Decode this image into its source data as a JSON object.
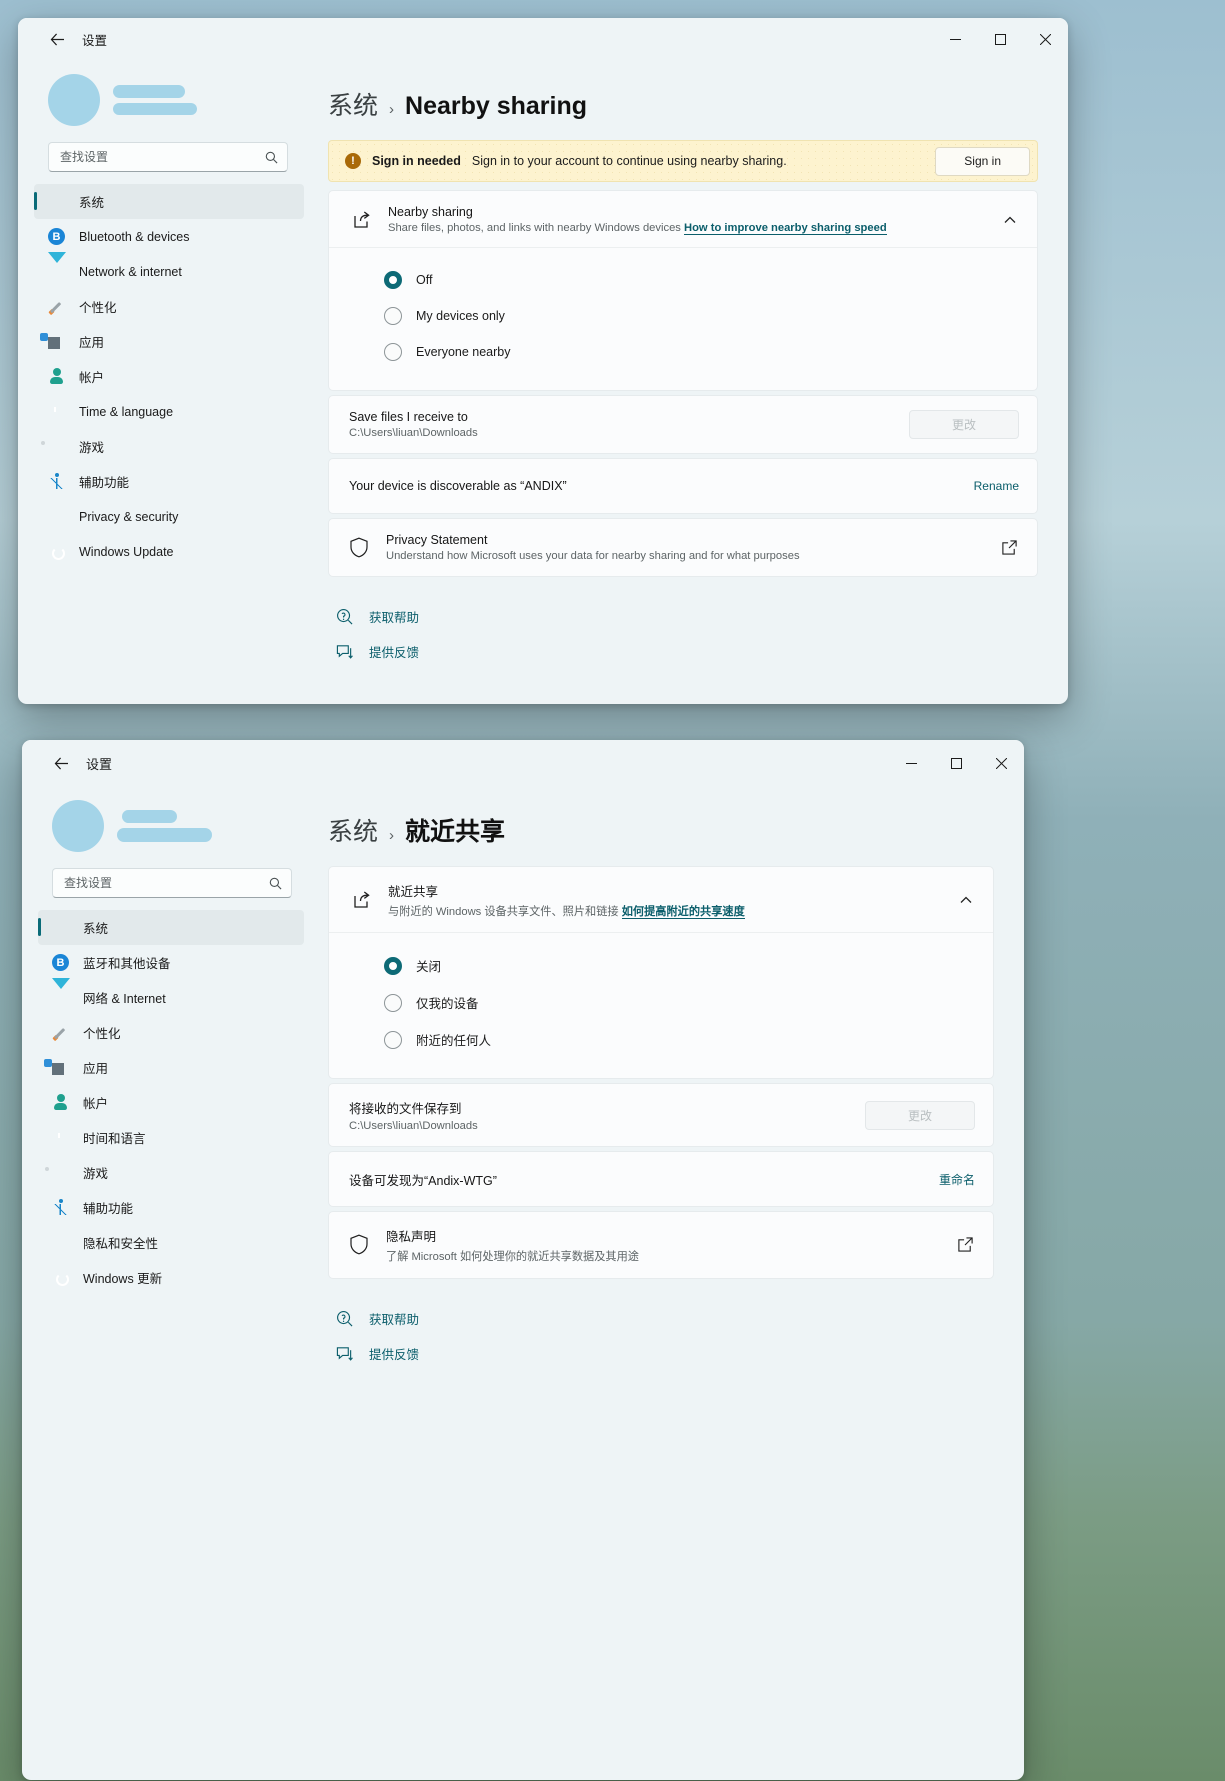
{
  "wallpaper": {
    "accent": "#9fc0cf"
  },
  "window_en": {
    "titlebar": {
      "title": "设置",
      "back_icon": "back-arrow-icon",
      "minimize": "minimize-icon",
      "maximize": "maximize-icon",
      "close": "close-icon"
    },
    "sidebar": {
      "search": {
        "placeholder": "查找设置",
        "value": "",
        "icon": "search-icon"
      },
      "items": [
        {
          "label": "系统",
          "icon": "system-icon",
          "active": true
        },
        {
          "label": "Bluetooth & devices",
          "icon": "bluetooth-icon",
          "active": false
        },
        {
          "label": "Network & internet",
          "icon": "network-icon",
          "active": false
        },
        {
          "label": "个性化",
          "icon": "personalization-icon",
          "active": false
        },
        {
          "label": "应用",
          "icon": "apps-icon",
          "active": false
        },
        {
          "label": "帐户",
          "icon": "accounts-icon",
          "active": false
        },
        {
          "label": "Time & language",
          "icon": "time-icon",
          "active": false
        },
        {
          "label": "游戏",
          "icon": "gaming-icon",
          "active": false
        },
        {
          "label": "辅助功能",
          "icon": "accessibility-icon",
          "active": false
        },
        {
          "label": "Privacy & security",
          "icon": "privacy-icon",
          "active": false
        },
        {
          "label": "Windows Update",
          "icon": "update-icon",
          "active": false
        }
      ]
    },
    "breadcrumb": {
      "root": "系统",
      "separator": "›",
      "current": "Nearby sharing"
    },
    "banner": {
      "icon": "alert-icon",
      "strong": "Sign in needed",
      "message": "Sign in to your account to continue using nearby sharing.",
      "button": "Sign in"
    },
    "feature_card": {
      "icon": "share-icon",
      "title": "Nearby sharing",
      "subtitle": "Share files, photos, and links with nearby Windows devices",
      "link": "How to improve nearby sharing speed",
      "chevron": "chevron-up-icon"
    },
    "options": [
      {
        "label": "Off",
        "selected": true
      },
      {
        "label": "My devices only",
        "selected": false
      },
      {
        "label": "Everyone nearby",
        "selected": false
      }
    ],
    "save_row": {
      "title": "Save files I receive to",
      "path": "C:\\Users\\liuan\\Downloads",
      "button": "更改"
    },
    "discover_row": {
      "title": "Your device is discoverable as “ANDIX”",
      "action": "Rename"
    },
    "privacy_row": {
      "icon": "shield-icon",
      "title": "Privacy Statement",
      "subtitle": "Understand how Microsoft uses your data for nearby sharing and for what purposes",
      "external_icon": "external-link-icon"
    },
    "footer": [
      {
        "label": "获取帮助",
        "icon": "help-icon"
      },
      {
        "label": "提供反馈",
        "icon": "feedback-icon"
      }
    ]
  },
  "window_zh": {
    "titlebar": {
      "title": "设置",
      "back_icon": "back-arrow-icon",
      "minimize": "minimize-icon",
      "maximize": "maximize-icon",
      "close": "close-icon"
    },
    "sidebar": {
      "search": {
        "placeholder": "查找设置",
        "value": "",
        "icon": "search-icon"
      },
      "items": [
        {
          "label": "系统",
          "icon": "system-icon",
          "active": true
        },
        {
          "label": "蓝牙和其他设备",
          "icon": "bluetooth-icon",
          "active": false
        },
        {
          "label": "网络 & Internet",
          "icon": "network-icon",
          "active": false
        },
        {
          "label": "个性化",
          "icon": "personalization-icon",
          "active": false
        },
        {
          "label": "应用",
          "icon": "apps-icon",
          "active": false
        },
        {
          "label": "帐户",
          "icon": "accounts-icon",
          "active": false
        },
        {
          "label": "时间和语言",
          "icon": "time-icon",
          "active": false
        },
        {
          "label": "游戏",
          "icon": "gaming-icon",
          "active": false
        },
        {
          "label": "辅助功能",
          "icon": "accessibility-icon",
          "active": false
        },
        {
          "label": "隐私和安全性",
          "icon": "privacy-icon",
          "active": false
        },
        {
          "label": "Windows 更新",
          "icon": "update-icon",
          "active": false
        }
      ]
    },
    "breadcrumb": {
      "root": "系统",
      "separator": "›",
      "current": "就近共享"
    },
    "feature_card": {
      "icon": "share-icon",
      "title": "就近共享",
      "subtitle": "与附近的 Windows 设备共享文件、照片和链接",
      "link": "如何提高附近的共享速度",
      "chevron": "chevron-up-icon"
    },
    "options": [
      {
        "label": "关闭",
        "selected": true
      },
      {
        "label": "仅我的设备",
        "selected": false
      },
      {
        "label": "附近的任何人",
        "selected": false
      }
    ],
    "save_row": {
      "title": "将接收的文件保存到",
      "path": "C:\\Users\\liuan\\Downloads",
      "button": "更改"
    },
    "discover_row": {
      "title": "设备可发现为“Andix-WTG”",
      "action": "重命名"
    },
    "privacy_row": {
      "icon": "shield-icon",
      "title": "隐私声明",
      "subtitle": "了解 Microsoft 如何处理你的就近共享数据及其用途",
      "external_icon": "external-link-icon"
    },
    "footer": [
      {
        "label": "获取帮助",
        "icon": "help-icon"
      },
      {
        "label": "提供反馈",
        "icon": "feedback-icon"
      }
    ]
  }
}
